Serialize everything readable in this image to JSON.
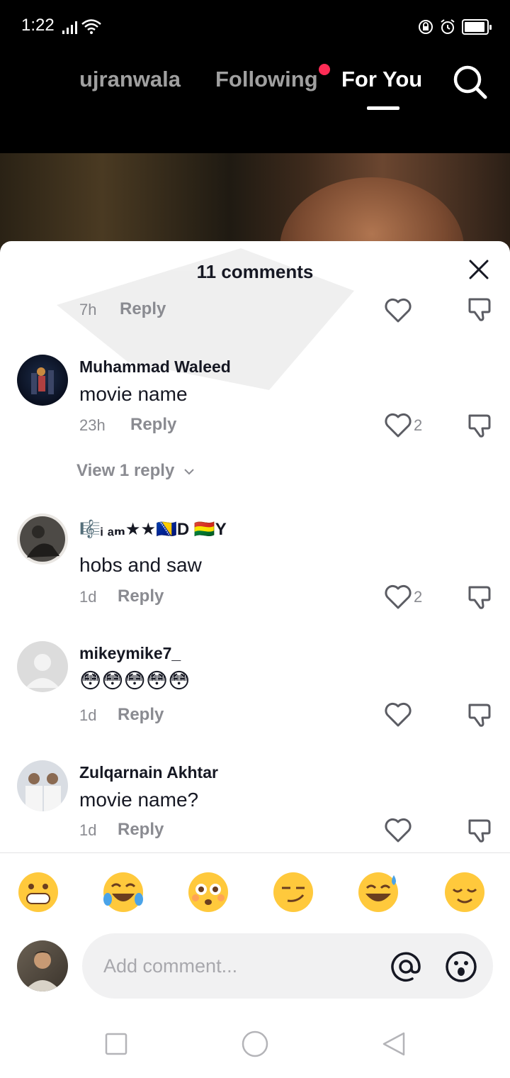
{
  "status_bar": {
    "time": "1:22",
    "icons": [
      "signal-icon",
      "wifi-icon",
      "lock-rotation-icon",
      "alarm-icon",
      "battery-icon"
    ]
  },
  "top_nav": {
    "tabs": [
      {
        "label": "ujranwala",
        "active": false
      },
      {
        "label": "Following",
        "active": false,
        "notification_dot": true
      },
      {
        "label": "For You",
        "active": true
      }
    ],
    "search_icon": "search-icon"
  },
  "sheet": {
    "title": "11 comments",
    "close_icon": "close-icon"
  },
  "comments": [
    {
      "user": "",
      "text": "",
      "time": "7h",
      "reply_label": "Reply",
      "likes": ""
    },
    {
      "user": "Muhammad Waleed",
      "text": "movie name",
      "time": "23h",
      "reply_label": "Reply",
      "likes": "2",
      "view_replies": "View 1 reply"
    },
    {
      "user_glyphs": "🎼ᵢ ₐₘ★★🇧🇦D 🇧🇴Y",
      "text": "hobs and saw",
      "time": "1d",
      "reply_label": "Reply",
      "likes": "2"
    },
    {
      "user": "mikeymike7_",
      "text": "😳😳😳😳😳",
      "time": "1d",
      "reply_label": "Reply",
      "likes": ""
    },
    {
      "user": "Zulqarnain Akhtar",
      "text": "movie name?",
      "time": "1d",
      "reply_label": "Reply",
      "likes": ""
    }
  ],
  "quick_emojis": [
    "😁",
    "😂",
    "😳",
    "😏",
    "😅",
    "😌"
  ],
  "composer": {
    "placeholder": "Add comment...",
    "at_icon": "at-icon",
    "emoji_icon": "emoji-icon"
  },
  "system_nav": [
    "recents-icon",
    "home-icon",
    "back-icon"
  ],
  "colors": {
    "accent_dot": "#fe2c55",
    "text_primary": "#161823",
    "text_secondary": "#8a8b91"
  }
}
